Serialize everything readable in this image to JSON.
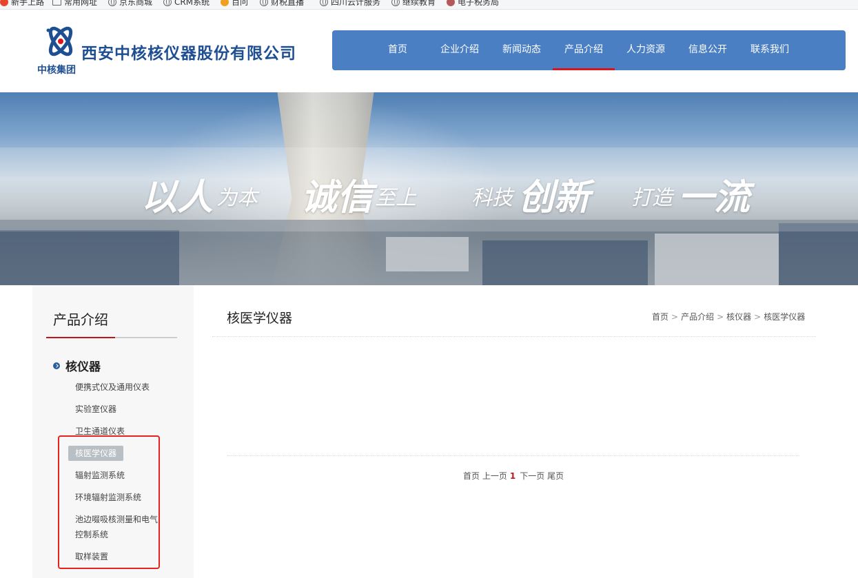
{
  "bookmarks": [
    {
      "label": "新手上路",
      "icon": "red-dot-icon"
    },
    {
      "label": "常用网址",
      "icon": "folder-icon"
    },
    {
      "label": "京东商城",
      "icon": "globe-icon"
    },
    {
      "label": "CRM系统",
      "icon": "globe-icon"
    },
    {
      "label": "百问",
      "icon": "orange-dot-icon"
    },
    {
      "label": "财税直播",
      "icon": "globe-icon"
    },
    {
      "label": "四川云计服务",
      "icon": "globe-icon"
    },
    {
      "label": "继续教育",
      "icon": "globe-icon"
    },
    {
      "label": "电子税务局",
      "icon": "tax-icon"
    }
  ],
  "header": {
    "company_name": "西安中核核仪器股份有限公司",
    "group_name": "中核集团"
  },
  "nav": {
    "items": [
      {
        "label": "首页"
      },
      {
        "label": "企业介绍"
      },
      {
        "label": "新闻动态"
      },
      {
        "label": "产品介绍"
      },
      {
        "label": "人力资源"
      },
      {
        "label": "信息公开"
      },
      {
        "label": "联系我们"
      }
    ],
    "active_index": 3,
    "bg_color": "#4a7fc4",
    "active_color": "#d9161c"
  },
  "banner": {
    "parts": [
      {
        "big": "以人",
        "small": "为本"
      },
      {
        "big": "诚信",
        "small": "至上"
      },
      {
        "small": "科技",
        "big": "创新"
      },
      {
        "small": "打造",
        "big": "一流"
      }
    ]
  },
  "sidebar": {
    "title": "产品介绍",
    "category": "核仪器",
    "items": [
      {
        "label": "便携式仪及通用仪表"
      },
      {
        "label": "实验室仪器"
      },
      {
        "label": "卫生通道仪表"
      },
      {
        "label": "核医学仪器"
      },
      {
        "label": "辐射监测系统"
      },
      {
        "label": "环境辐射监测系统"
      },
      {
        "label": "池边啜吸核测量和电气控制系统"
      },
      {
        "label": "取样装置"
      }
    ],
    "active_index": 3
  },
  "main": {
    "title": "核医学仪器",
    "breadcrumb": [
      "首页",
      "产品介绍",
      "核仪器",
      "核医学仪器"
    ],
    "breadcrumb_sep": ">",
    "pager": {
      "first": "首页",
      "prev": "上一页",
      "current": "1",
      "next": "下一页",
      "last": "尾页"
    }
  }
}
